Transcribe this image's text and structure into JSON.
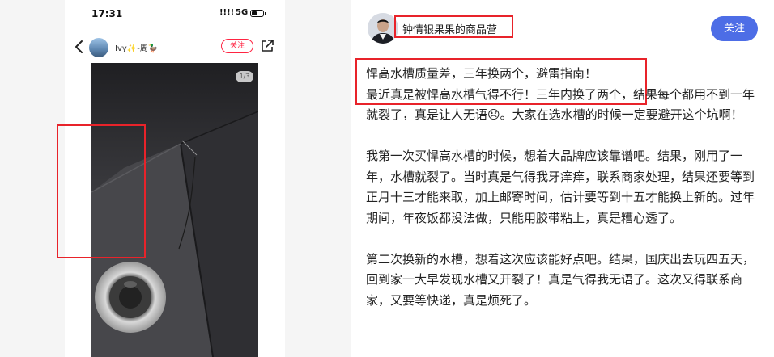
{
  "phone": {
    "status_time": "17:31",
    "status_signal": "!!!!",
    "status_network": "5G",
    "username": "Ivy✨-周🦆",
    "follow_label": "关注",
    "image_counter": "1/3"
  },
  "author": {
    "name": "钟情银果果的商品营",
    "follow_label": "关注"
  },
  "post": {
    "title": "悍高水槽质量差，三年换两个，避雷指南！",
    "paragraphs": [
      "最近真是被悍高水槽气得不行！三年内换了两个，结果每个都用不到一年就裂了，真是让人无语😞。大家在选水槽的时候一定要避开这个坑啊！",
      "我第一次买悍高水槽的时候，想着大品牌应该靠谱吧。结果，刚用了一年，水槽就裂了。当时真是气得我牙痒痒，联系商家处理，结果还要等到正月十三才能来取，加上邮寄时间，估计要等到十五才能换上新的。过年期间，年夜饭都没法做，只能用胶带粘上，真是糟心透了。",
      "第二次换新的水槽，想着这次应该能好点吧。结果，国庆出去玩四五天，回到家一大早发现水槽又开裂了！真是气得我无语了。这次又得联系商家，又要等快递，真是烦死了。"
    ]
  },
  "colors": {
    "accent": "#4d6de6",
    "highlight": "#e8232a",
    "brand_red": "#ff2442"
  }
}
